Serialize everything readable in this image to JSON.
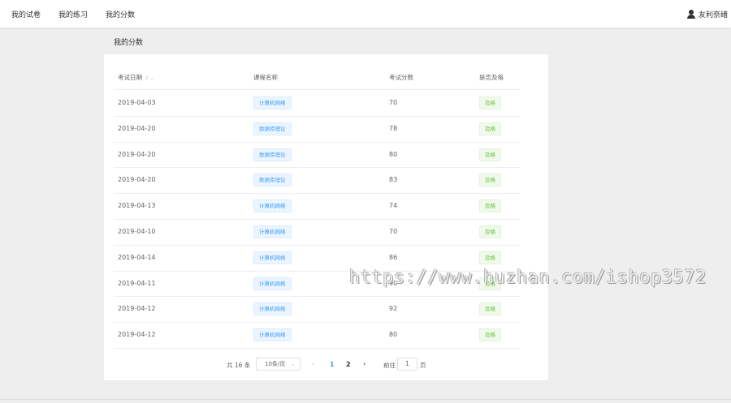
{
  "nav": {
    "items": [
      {
        "label": "我的试卷"
      },
      {
        "label": "我的练习"
      },
      {
        "label": "我的分数"
      }
    ],
    "user_name": "友利奈绪",
    "user_icon": "user-icon"
  },
  "page": {
    "title": "我的分数"
  },
  "table": {
    "columns": [
      "考试日期",
      "课程名称",
      "考试分数",
      "是否及格"
    ],
    "sort_icon": "sort-icon",
    "rows": [
      {
        "date": "2019-04-03",
        "course": "计算机网络",
        "score": "70",
        "pass": "及格"
      },
      {
        "date": "2019-04-20",
        "course": "数据库理论",
        "score": "78",
        "pass": "及格"
      },
      {
        "date": "2019-04-20",
        "course": "数据库理论",
        "score": "80",
        "pass": "及格"
      },
      {
        "date": "2019-04-20",
        "course": "数据库理论",
        "score": "83",
        "pass": "及格"
      },
      {
        "date": "2019-04-13",
        "course": "计算机网络",
        "score": "74",
        "pass": "及格"
      },
      {
        "date": "2019-04-10",
        "course": "计算机网络",
        "score": "70",
        "pass": "及格"
      },
      {
        "date": "2019-04-14",
        "course": "计算机网络",
        "score": "86",
        "pass": "及格"
      },
      {
        "date": "2019-04-11",
        "course": "计算机网络",
        "score": "90",
        "pass": "及格"
      },
      {
        "date": "2019-04-12",
        "course": "计算机网络",
        "score": "92",
        "pass": "及格"
      },
      {
        "date": "2019-04-12",
        "course": "计算机网络",
        "score": "80",
        "pass": "及格"
      }
    ]
  },
  "pagination": {
    "total_text": "共 16 条",
    "page_size": "10条/页",
    "pages": [
      "1",
      "2"
    ],
    "current_page": "1",
    "goto_label": "前往",
    "goto_value": "1",
    "page_suffix": "页"
  },
  "watermark": "https://www.huzhan.com/ishop3572",
  "colors": {
    "primary": "#409eff",
    "success": "#67c23a",
    "background": "#eeeeee"
  }
}
